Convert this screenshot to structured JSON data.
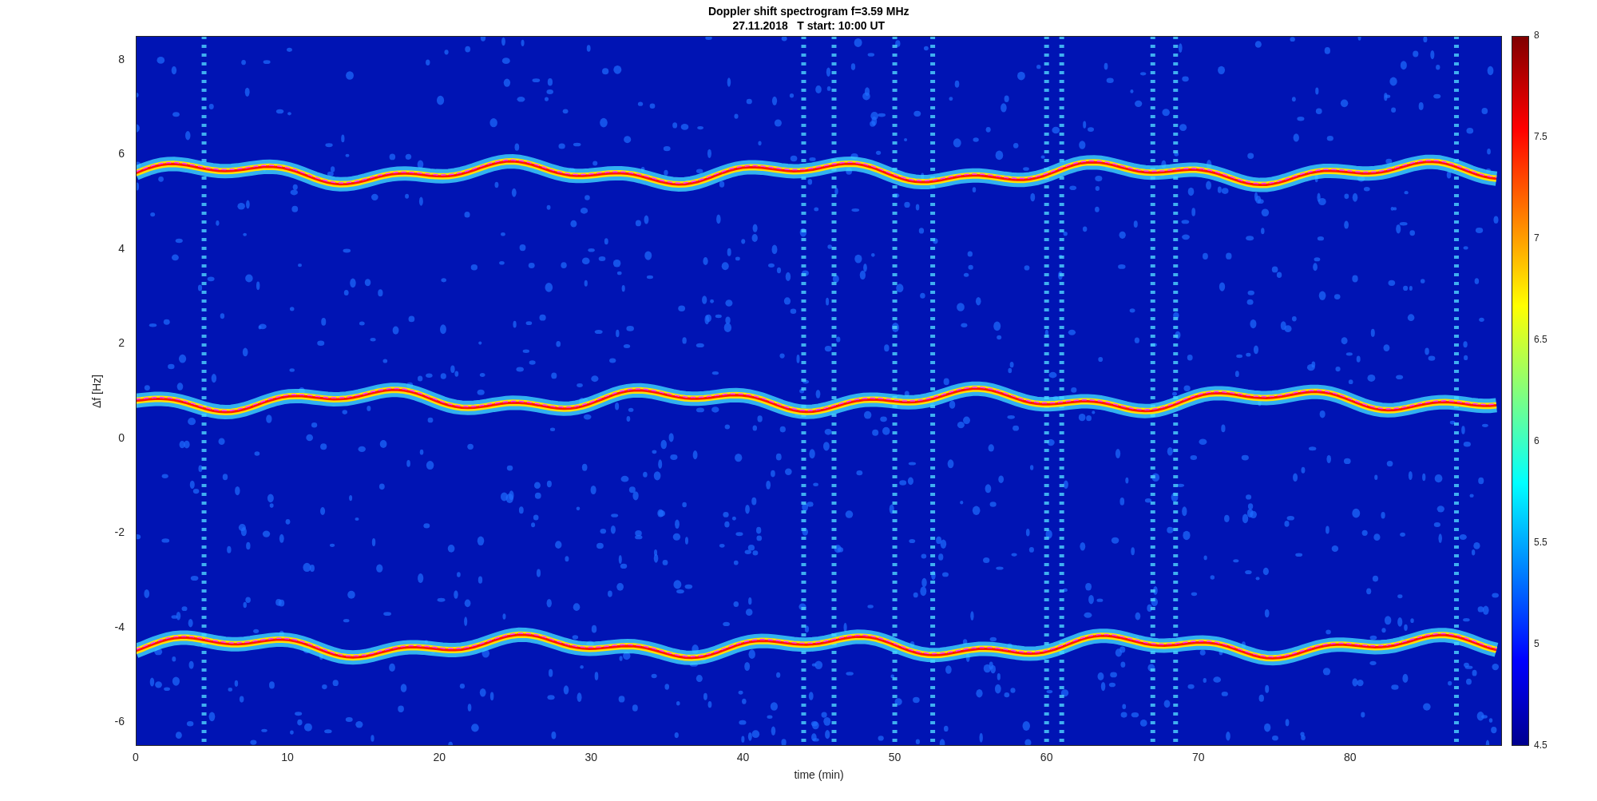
{
  "figure": {
    "title": "Doppler shift spectrogram f=3.59 MHz",
    "subtitle": "27.11.2018   T start: 10:00 UT"
  },
  "axes": {
    "xlabel": "time (min)",
    "ylabel": "Δf [Hz]",
    "xticks": [
      "0",
      "10",
      "20",
      "30",
      "40",
      "50",
      "60",
      "70",
      "80"
    ],
    "yticks": [
      "8",
      "6",
      "4",
      "2",
      "0",
      "-2",
      "-4",
      "-6"
    ]
  },
  "colorbar": {
    "ticks": [
      "8",
      "7.5",
      "7",
      "6.5",
      "6",
      "5.5",
      "5",
      "4.5"
    ]
  }
}
